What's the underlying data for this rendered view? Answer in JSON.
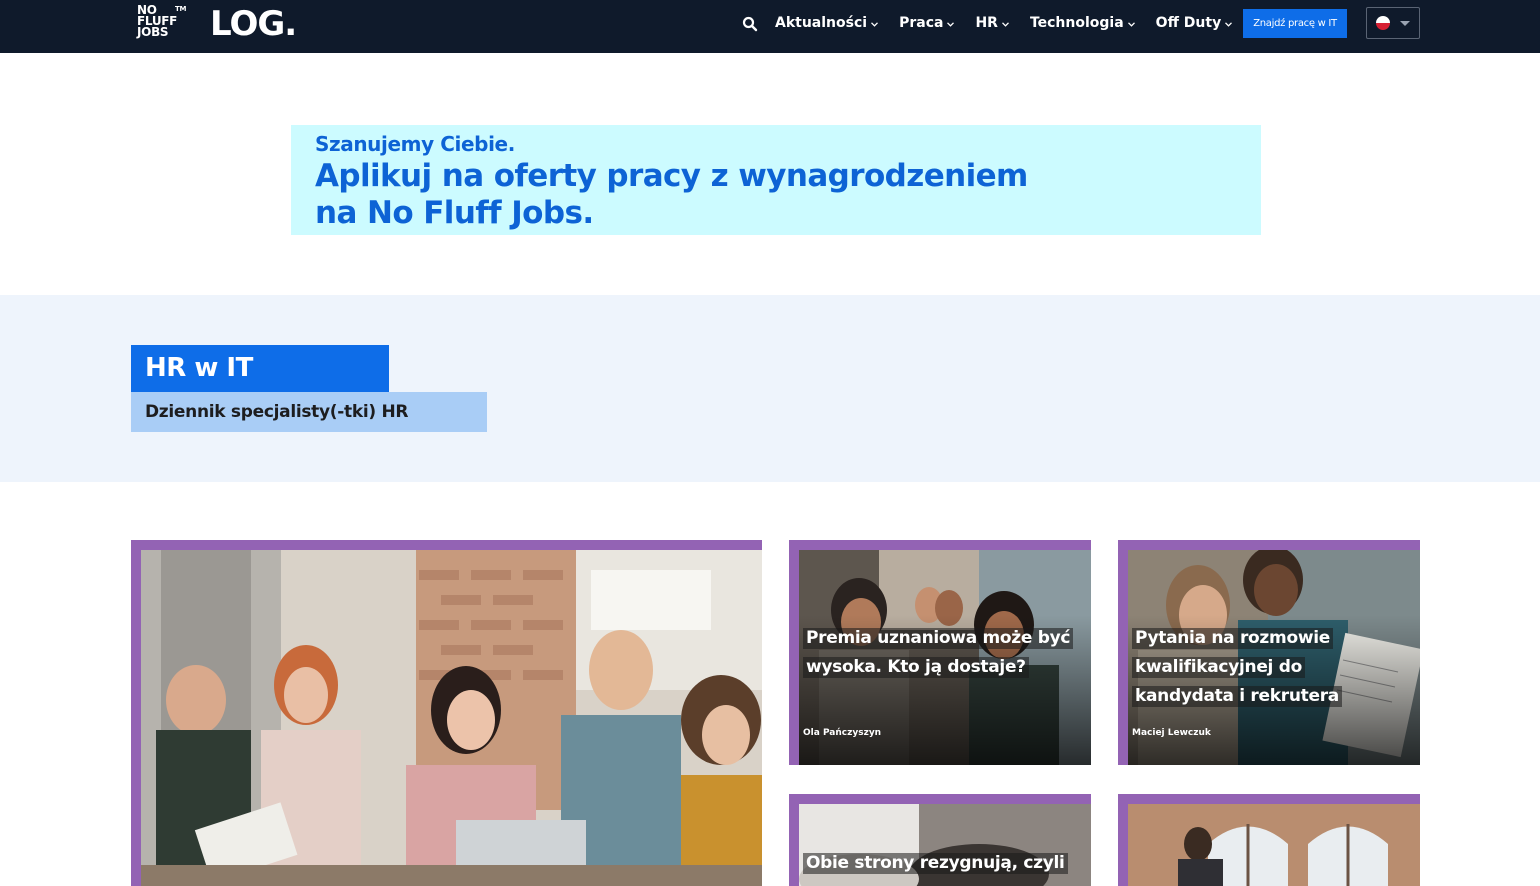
{
  "header": {
    "logo_brand": "NO\nFLUFF\nJOBS",
    "logo_tm": "TM",
    "logo_log": "LOG.",
    "nav_items": [
      {
        "label": "Aktualności"
      },
      {
        "label": "Praca"
      },
      {
        "label": "HR"
      },
      {
        "label": "Technologia"
      },
      {
        "label": "Off Duty"
      }
    ],
    "cta_label": "Znajdź pracę w IT",
    "language": "pl-flag-icon"
  },
  "banner": {
    "small": "Szanujemy Ciebie.",
    "big": "Aplikuj na oferty pracy z wynagrodzeniem na No Fluff Jobs."
  },
  "category": {
    "title": "HR w IT",
    "subtitle": "Dziennik specjalisty(-tki) HR"
  },
  "articles": [
    {
      "title": "",
      "author": ""
    },
    {
      "title": "Premia uznaniowa może być wysoka. Kto ją dostaje?",
      "author": "Ola Pańczyszyn"
    },
    {
      "title": "Pytania na rozmowie kwalifikacyjnej do kandydata i rekrutera",
      "author": "Maciej Lewczuk"
    },
    {
      "title": "Obie strony rezygnują, czyli",
      "author": ""
    },
    {
      "title": "",
      "author": ""
    }
  ],
  "colors": {
    "topbar": "#0f1a2b",
    "accent": "#0e6de8",
    "banner_bg": "#ccfbff",
    "banner_text": "#0d63d5",
    "card_border": "#9363b4",
    "category_band": "#eef4fc"
  }
}
